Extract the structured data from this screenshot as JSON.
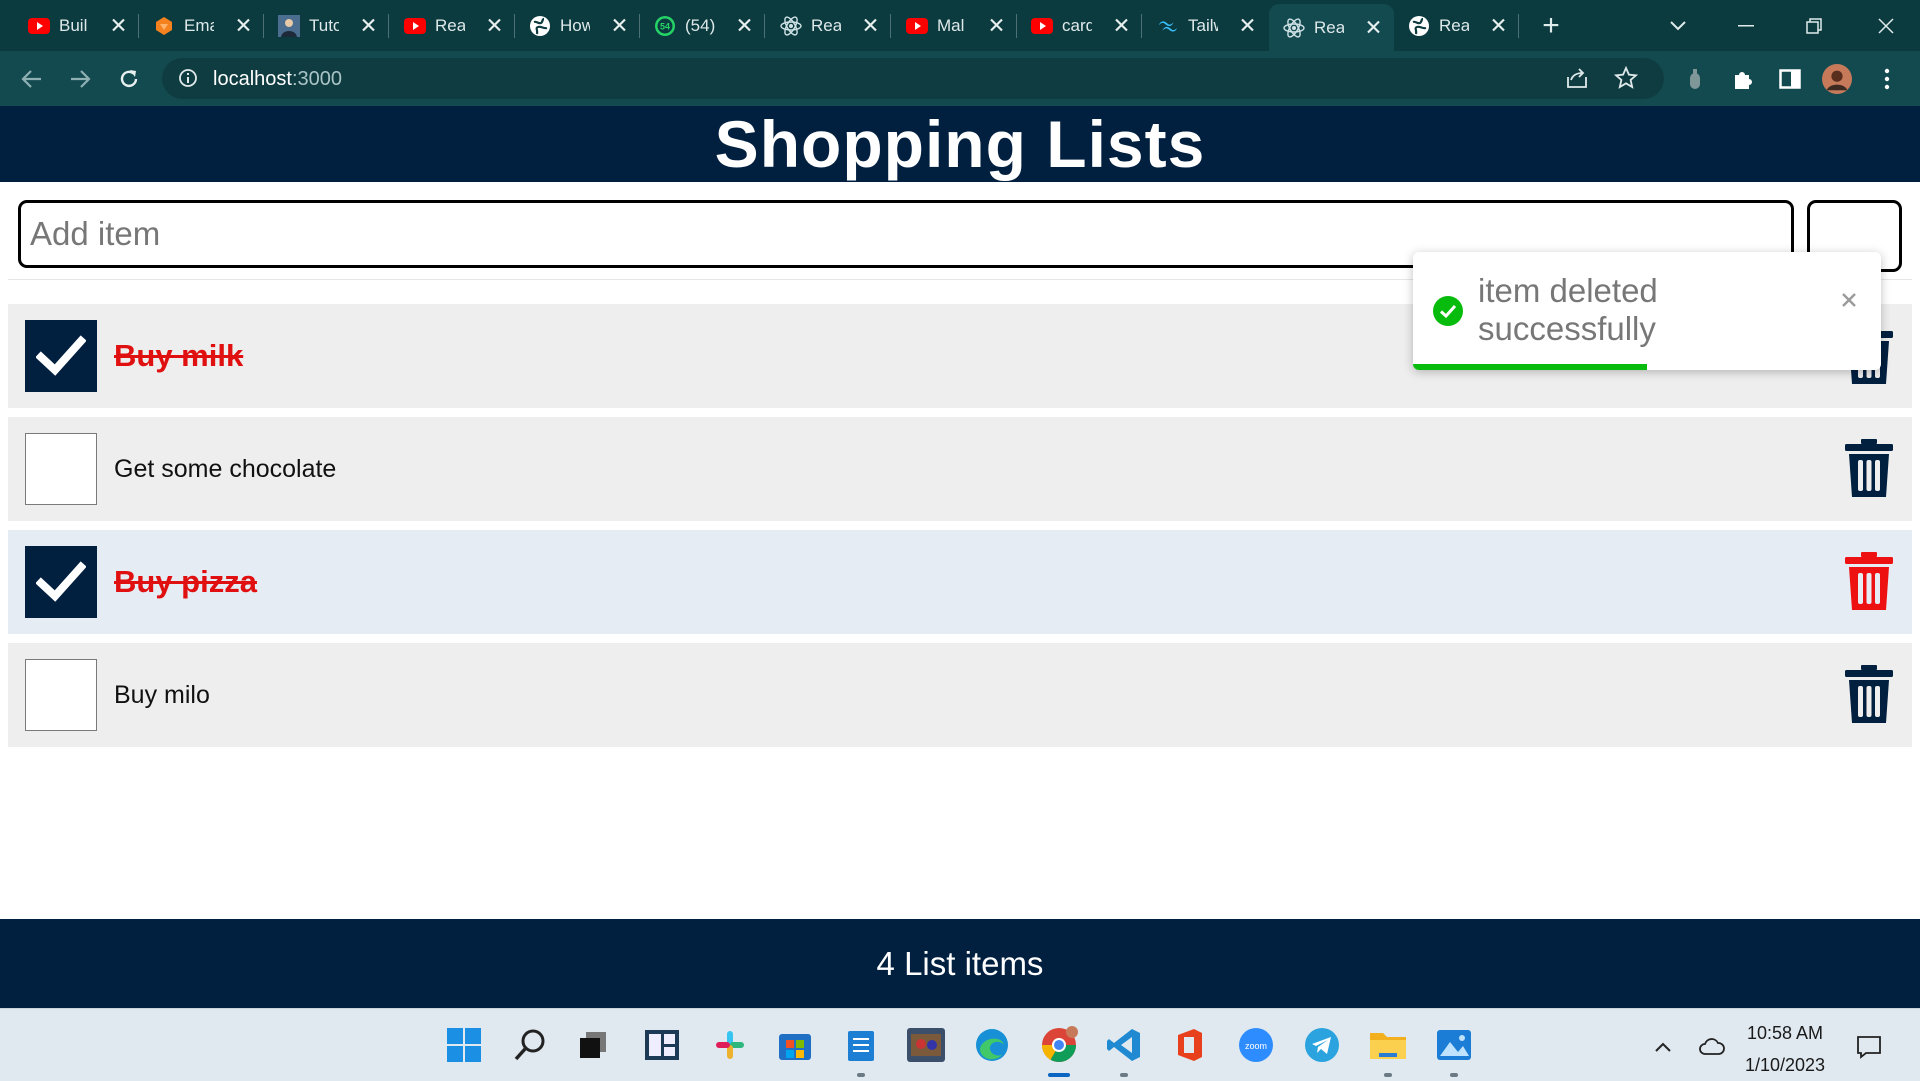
{
  "browser": {
    "tabs": [
      {
        "title": "Buil",
        "icon": "youtube-icon",
        "active": false
      },
      {
        "title": "Ema",
        "icon": "cloudflare-icon",
        "active": false
      },
      {
        "title": "Tuto",
        "icon": "person-avatar-icon",
        "active": false
      },
      {
        "title": "Rea",
        "icon": "youtube-icon",
        "active": false
      },
      {
        "title": "How",
        "icon": "globe-icon",
        "active": false
      },
      {
        "title": "(54)",
        "icon": "whatsapp-icon",
        "active": false
      },
      {
        "title": "Rea",
        "icon": "react-icon",
        "active": false
      },
      {
        "title": "Mal",
        "icon": "youtube-icon",
        "active": false
      },
      {
        "title": "card",
        "icon": "youtube-icon",
        "active": false
      },
      {
        "title": "Tailw",
        "icon": "tailwind-icon",
        "active": false
      },
      {
        "title": "Rea",
        "icon": "react-icon",
        "active": true
      },
      {
        "title": "Rea",
        "icon": "globe-icon",
        "active": false
      }
    ],
    "whatsapp_badge": "54",
    "url_host": "localhost",
    "url_port": ":3000"
  },
  "app": {
    "title": "Shopping Lists",
    "add_placeholder": "Add item",
    "items": [
      {
        "label": "Buy milk",
        "checked": true
      },
      {
        "label": "Get some chocolate",
        "checked": false
      },
      {
        "label": "Buy pizza",
        "checked": true
      },
      {
        "label": "Buy milo",
        "checked": false
      }
    ],
    "footer": "4 List items"
  },
  "toast": {
    "message": "item deleted successfully",
    "progress": 0.5,
    "accent": "#07bc0c"
  },
  "colors": {
    "primary": "#011f3f",
    "done_text": "#e01010",
    "delete_hover": "#ee1111"
  },
  "taskbar": {
    "time": "10:58 AM",
    "date": "1/10/2023"
  }
}
